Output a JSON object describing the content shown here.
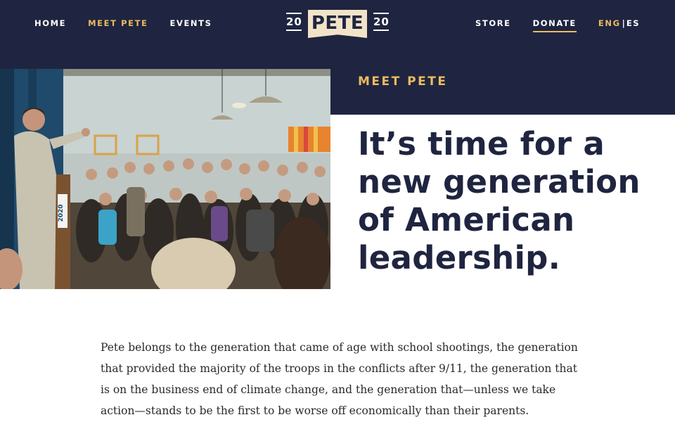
{
  "nav": {
    "left": [
      "HOME",
      "MEET PETE",
      "EVENTS"
    ],
    "right": [
      "STORE",
      "DONATE"
    ],
    "language": {
      "en": "ENG",
      "separator": "|",
      "es": "ES"
    }
  },
  "logo": {
    "year_left": "20",
    "name": "PETE",
    "year_right": "20"
  },
  "hero": {
    "eyebrow": "MEET PETE",
    "headline": "It’s time for a new generation of American leadership."
  },
  "body": {
    "paragraph": "Pete belongs to the generation that came of age with school shootings, the generation that provided the majority of the troops in the conflicts after 9/11, the generation that is on the business end of climate change, and the generation that—unless we take action—stands to be the first to be worse off economically than their parents."
  },
  "photo": {
    "sign_text": "2020"
  },
  "colors": {
    "navy": "#1f2540",
    "gold": "#ecbb61",
    "cream": "#f2e3c8",
    "white": "#ffffff"
  }
}
